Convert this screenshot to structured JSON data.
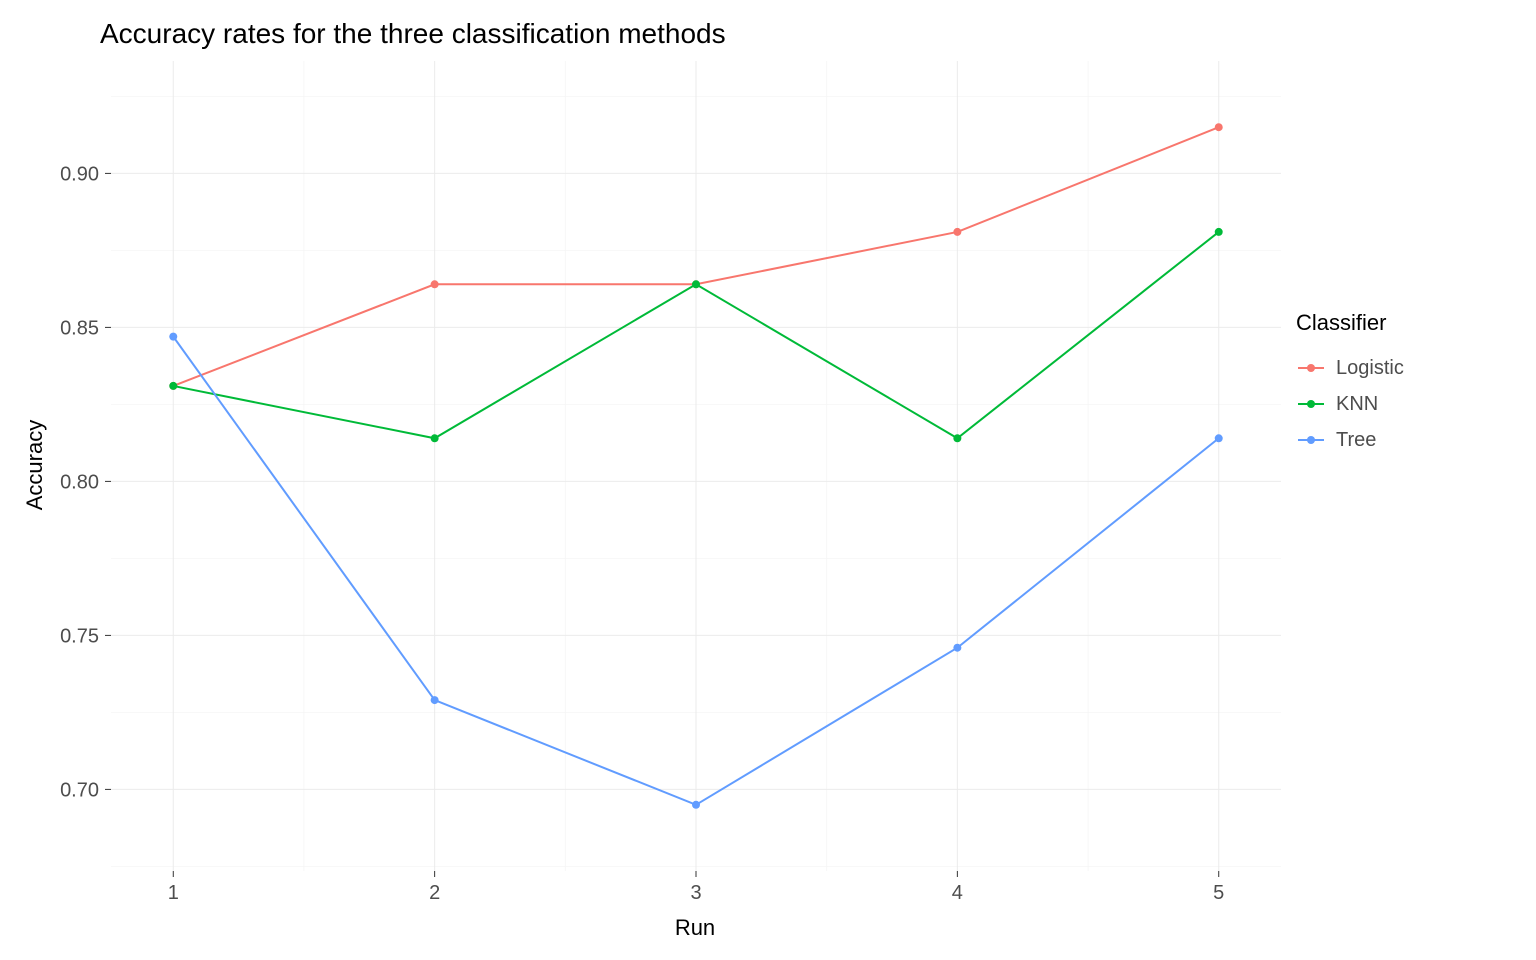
{
  "chart_data": {
    "type": "line",
    "title": "Accuracy rates for the three classification methods",
    "xlabel": "Run",
    "ylabel": "Accuracy",
    "x": [
      1,
      2,
      3,
      4,
      5
    ],
    "x_ticks": [
      "1",
      "2",
      "3",
      "4",
      "5"
    ],
    "y_ticks": [
      "0.70",
      "0.75",
      "0.80",
      "0.85",
      "0.90"
    ],
    "ylim": [
      0.68,
      0.93
    ],
    "series": [
      {
        "name": "Logistic",
        "color": "#F8766D",
        "values": [
          0.831,
          0.864,
          0.864,
          0.881,
          0.915
        ]
      },
      {
        "name": "KNN",
        "color": "#00BA38",
        "values": [
          0.831,
          0.814,
          0.864,
          0.814,
          0.881
        ]
      },
      {
        "name": "Tree",
        "color": "#619CFF",
        "values": [
          0.847,
          0.729,
          0.695,
          0.746,
          0.814
        ]
      }
    ],
    "legend_title": "Classifier"
  }
}
